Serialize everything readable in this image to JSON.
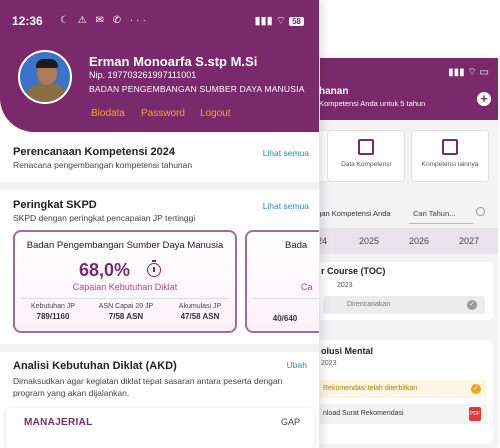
{
  "status_bar": {
    "time": "12:36",
    "icons": "☾ ⚠ ✉ ✆ ···",
    "right": "▮▮▮ ⌔",
    "battery": "58"
  },
  "profile": {
    "name": "Erman Monoarfa S.stp M.Si",
    "nip": "Nip. 197703261997111001",
    "unit": "BADAN PENGEMBANGAN SUMBER DAYA MANUSIA",
    "links": [
      "Biodata",
      "Password",
      "Logout"
    ]
  },
  "perencanaan": {
    "title": "Perencanaan Kompetensi  2024",
    "subtitle": "Renacana pengembangan kompetensi tahunan",
    "see_all": "Lihat semua"
  },
  "peringkat": {
    "title": "Peringkat SKPD",
    "subtitle": "SKPD dengan peringkat pencapaian JP tertinggi",
    "see_all": "Lihat semua",
    "cards": [
      {
        "name": "Badan Pengembangan Sumber Daya Manusia",
        "percent": "68,0%",
        "caption": "Capaian Kebutuhan Diklat",
        "stats": [
          {
            "label": "Kebutuhan JP",
            "value": "789/1160"
          },
          {
            "label": "ASN Capai 20 JP",
            "value": "7/58 ASN"
          },
          {
            "label": "Akumulasi JP",
            "value": "47/58 ASN"
          }
        ]
      },
      {
        "name": "Bada",
        "caption": "Ca",
        "value": "40/640"
      }
    ]
  },
  "akd": {
    "title": "Analisi Kebutuhan Diklat (AKD)",
    "ubah": "Ubah",
    "desc": "Dimaksudkan agar kegiatan diklat tepat sasaran antara peserta dengan program yang akan dijalankan.",
    "category": "MANAJERIAL",
    "gap": "GAP"
  },
  "back": {
    "status": "▮▮▮ ⌔ ▭",
    "title": "hanan",
    "subtitle": "Kompetensi Anda untuk 5 tahun",
    "cards": [
      "",
      "Data Kompetensi",
      "Kompetensi lainnya"
    ],
    "search_label": "ngan Kompetensi Anda",
    "search_placeholder": "Cari Tahun...",
    "years": [
      "24",
      "2025",
      "2026",
      "2027"
    ],
    "toc": {
      "title": "r Course (TOC)",
      "year": "2023",
      "status": "Direncanakan"
    },
    "rev": {
      "title": "olusi Mental",
      "year": "2023",
      "row1": "Rekomendasi telah diterbitkan",
      "row2": "nload Surat Rekomendasi",
      "pdf": "PDF"
    }
  },
  "colors": {
    "brand": "#7a2a6c",
    "accent": "#f5a524",
    "link": "#2a88c8"
  }
}
